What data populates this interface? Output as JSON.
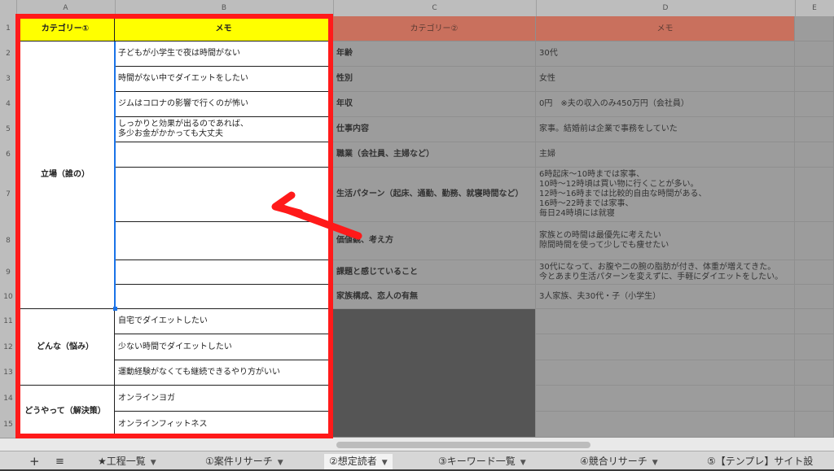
{
  "columns": {
    "a": "A",
    "b": "B",
    "c": "C",
    "d": "D",
    "e": "E"
  },
  "rows": [
    "1",
    "2",
    "3",
    "4",
    "5",
    "6",
    "7",
    "8",
    "9",
    "10",
    "11",
    "12",
    "13",
    "14",
    "15"
  ],
  "left": {
    "header_category": "カテゴリー①",
    "header_memo": "メモ",
    "group1_label": "立場（誰の）",
    "group2_label": "どんな（悩み）",
    "group3_label": "どうやって（解決策）",
    "memos": [
      "子どもが小学生で夜は時間がない",
      "時間がない中でダイエットをしたい",
      "ジムはコロナの影響で行くのが怖い",
      "しっかりと効果が出るのであれば、\n多少お金がかかっても大丈夫",
      "",
      "",
      "",
      "",
      "",
      "自宅でダイエットしたい",
      "少ない時間でダイエットしたい",
      "運動経験がなくても継続できるやり方がいい",
      "オンラインヨガ",
      "オンラインフィットネス"
    ]
  },
  "right": {
    "header_category": "カテゴリー②",
    "header_memo": "メモ",
    "items": [
      {
        "label": "年齢",
        "value": "30代"
      },
      {
        "label": "性別",
        "value": "女性"
      },
      {
        "label": "年収",
        "value": "0円　※夫の収入のみ450万円（会社員）"
      },
      {
        "label": "仕事内容",
        "value": "家事。結婚前は企業で事務をしていた"
      },
      {
        "label": "職業（会社員、主婦など）",
        "value": "主婦"
      },
      {
        "label": "生活パターン（起床、通勤、勤務、就寝時間など）",
        "value": "6時起床〜10時までは家事、\n10時〜12時頃は買い物に行くことが多い。\n12時〜16時までは比較的自由な時間がある、\n16時〜22時までは家事、\n毎日24時頃には就寝"
      },
      {
        "label": "価値観、考え方",
        "value": "家族との時間は最優先に考えたい\n隙間時間を使って少しでも痩せたい"
      },
      {
        "label": "課題と感じていること",
        "value": "30代になって、お腹や二の腕の脂肪が付き、体重が増えてきた。\n今とあまり生活パターンを変えずに、手軽にダイエットをしたい。"
      },
      {
        "label": "家族構成、恋人の有無",
        "value": "3人家族、夫30代・子（小学生）"
      }
    ]
  },
  "tabs": [
    {
      "label": "★工程一覧"
    },
    {
      "label": "①案件リサーチ"
    },
    {
      "label": "②想定読者"
    },
    {
      "label": "③キーワード一覧"
    },
    {
      "label": "④競合リサーチ"
    },
    {
      "label": "⑤【テンプレ】サイト設"
    }
  ],
  "icons": {
    "add": "plus-icon",
    "menu": "list-icon"
  },
  "colors": {
    "highlight_frame": "#ff1a1a",
    "header_yellow": "#ffff00",
    "header_orange": "#c9705d"
  }
}
